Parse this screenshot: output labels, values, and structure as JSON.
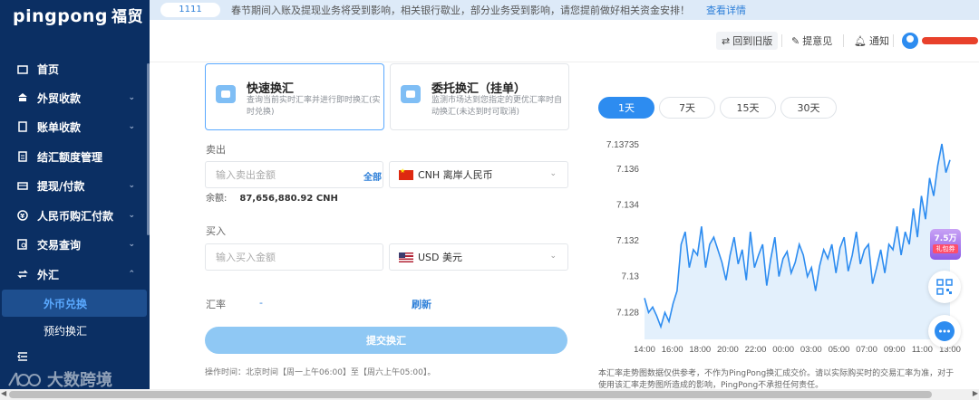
{
  "app": {
    "logo_text": "pingpong",
    "logo_cn": "福贸"
  },
  "sidebar": {
    "items": [
      {
        "label": "首页",
        "icon": "chart-icon"
      },
      {
        "label": "外贸收款",
        "icon": "bank-icon"
      },
      {
        "label": "账单收款",
        "icon": "bill-icon"
      },
      {
        "label": "结汇额度管理",
        "icon": "document-icon"
      },
      {
        "label": "提现/付款",
        "icon": "wallet-icon"
      },
      {
        "label": "人民币购汇付款",
        "icon": "yuan-icon"
      },
      {
        "label": "交易查询",
        "icon": "search-doc-icon"
      },
      {
        "label": "外汇",
        "icon": "exchange-icon"
      }
    ],
    "sub_items": [
      {
        "label": "外币兑换",
        "active": true
      },
      {
        "label": "预约换汇",
        "active": false
      }
    ],
    "watermark": "大数跨境"
  },
  "notice": {
    "badge": "1111",
    "message": "春节期间入账及提现业务将受到影响，相关银行歇业，部分业务受到影响，请您提前做好相关资金安排！",
    "link": "查看详情"
  },
  "header": {
    "back_old": "回到旧版",
    "feedback": "提意见",
    "notifications": "通知"
  },
  "exchange": {
    "modes": [
      {
        "title": "快速换汇",
        "desc": "查询当前实时汇率并进行即时换汇(实时兑换)",
        "active": true
      },
      {
        "title": "委托换汇（挂单）",
        "desc": "监测市场达到您指定的更优汇率时自动换汇(未达到时可取消)",
        "active": false
      }
    ],
    "sell": {
      "label": "卖出",
      "placeholder": "输入卖出金额",
      "all_label": "全部",
      "currency": "CNH 离岸人民币",
      "balance_label": "余额:",
      "balance_value": "87,656,880.92 CNH"
    },
    "buy": {
      "label": "买入",
      "placeholder": "输入买入金额",
      "currency": "USD 美元"
    },
    "rate_label": "汇率",
    "rate_value": "-",
    "refresh_label": "刷新",
    "submit_label": "提交换汇",
    "op_time": "操作时间：北京时间【周一上午06:00】至【周六上午05:00】。"
  },
  "range_tabs": [
    {
      "label": "1天",
      "active": true
    },
    {
      "label": "7天",
      "active": false
    },
    {
      "label": "15天",
      "active": false
    },
    {
      "label": "30天",
      "active": false
    }
  ],
  "chart_data": {
    "type": "area",
    "x": [
      "14:00",
      "16:00",
      "18:00",
      "20:00",
      "22:00",
      "00:00",
      "03:00",
      "05:00",
      "07:00",
      "09:00",
      "11:00",
      "13:00"
    ],
    "series": [
      {
        "values": [
          7.1288,
          7.128,
          7.1283,
          7.1278,
          7.1272,
          7.128,
          7.1275,
          7.1285,
          7.1292,
          7.1318,
          7.1325,
          7.1305,
          7.1315,
          7.1312,
          7.1328,
          7.1305,
          7.1318,
          7.1322,
          7.1315,
          7.1308,
          7.1298,
          7.1312,
          7.1322,
          7.1307,
          7.1315,
          7.1298,
          7.1325,
          7.1305,
          7.1312,
          7.1318,
          7.1295,
          7.131,
          7.1322,
          7.13,
          7.131,
          7.1314,
          7.1302,
          7.1308,
          7.1318,
          7.1312,
          7.13,
          7.1305,
          7.1292,
          7.1306,
          7.1315,
          7.131,
          7.1318,
          7.1302,
          7.1316,
          7.1322,
          7.1303,
          7.1312,
          7.1325,
          7.1307,
          7.1315,
          7.1318,
          7.1296,
          7.1305,
          7.1315,
          7.1302,
          7.1318,
          7.1315,
          7.1328,
          7.1312,
          7.1325,
          7.1318,
          7.1338,
          7.1322,
          7.1345,
          7.1332,
          7.1355,
          7.1345,
          7.1362,
          7.1374,
          7.1358,
          7.1365
        ]
      }
    ],
    "y_ticks": [
      7.128,
      7.13,
      7.132,
      7.134,
      7.136,
      7.13735
    ],
    "ylim": [
      7.1265,
      7.13735
    ],
    "grid": false,
    "note": "本汇率走势图数据仅供参考，不作为PingPong换汇成交价。请以实际购买时的交易汇率为准，对于使用该汇率走势图所造成的影响，PingPong不承担任何责任。"
  },
  "promo": {
    "amount": "7.5万",
    "label": "礼包券"
  },
  "colors": {
    "sidebar": "#0b2f63",
    "accent": "#2d8cf0",
    "line": "#2d8cf0",
    "submit": "#8fc8f4"
  }
}
